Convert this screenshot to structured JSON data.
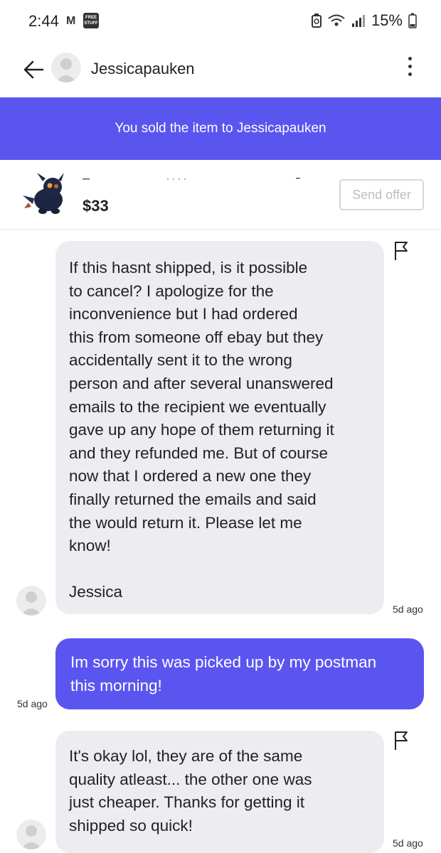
{
  "status_bar": {
    "time": "2:44",
    "mail_indicator": "M",
    "free_stuff_badge": "FREE STUFF",
    "battery_percent": "15%",
    "icons": [
      "mail-icon",
      "free-stuff-icon",
      "battery-saver-icon",
      "wifi-icon",
      "signal-icon",
      "battery-icon"
    ]
  },
  "header": {
    "back_icon": "arrow-left-icon",
    "contact_name": "Jessicapauken",
    "more_icon": "more-vertical-icon"
  },
  "banner": {
    "text": "You sold the item to Jessicapauken",
    "color": "#5b55f0"
  },
  "item": {
    "price": "$33",
    "send_offer_label": "Send offer"
  },
  "messages": [
    {
      "direction": "incoming",
      "text": "If this hasnt shipped, is it possible\nto cancel? I apologize for the\ninconvenience but I had ordered\nthis from someone off ebay but they\naccidentally sent it to the wrong\nperson and after several  unanswered\nemails to the recipient we eventually\ngave up any hope of them returning it\nand they refunded me. But of course\nnow that I ordered a new one they\nfinally returned the emails and said\nthe would return it.  Please let me\nknow!\n\nJessica",
      "timestamp": "5d ago"
    },
    {
      "direction": "outgoing",
      "text": "Im sorry this was picked up by my postman\nthis morning!",
      "timestamp": "5d ago"
    },
    {
      "direction": "incoming",
      "text": "It's okay lol, they are of the same\nquality atleast... the other one was\njust cheaper. Thanks for getting it\nshipped so quick!",
      "timestamp": "5d ago"
    }
  ]
}
